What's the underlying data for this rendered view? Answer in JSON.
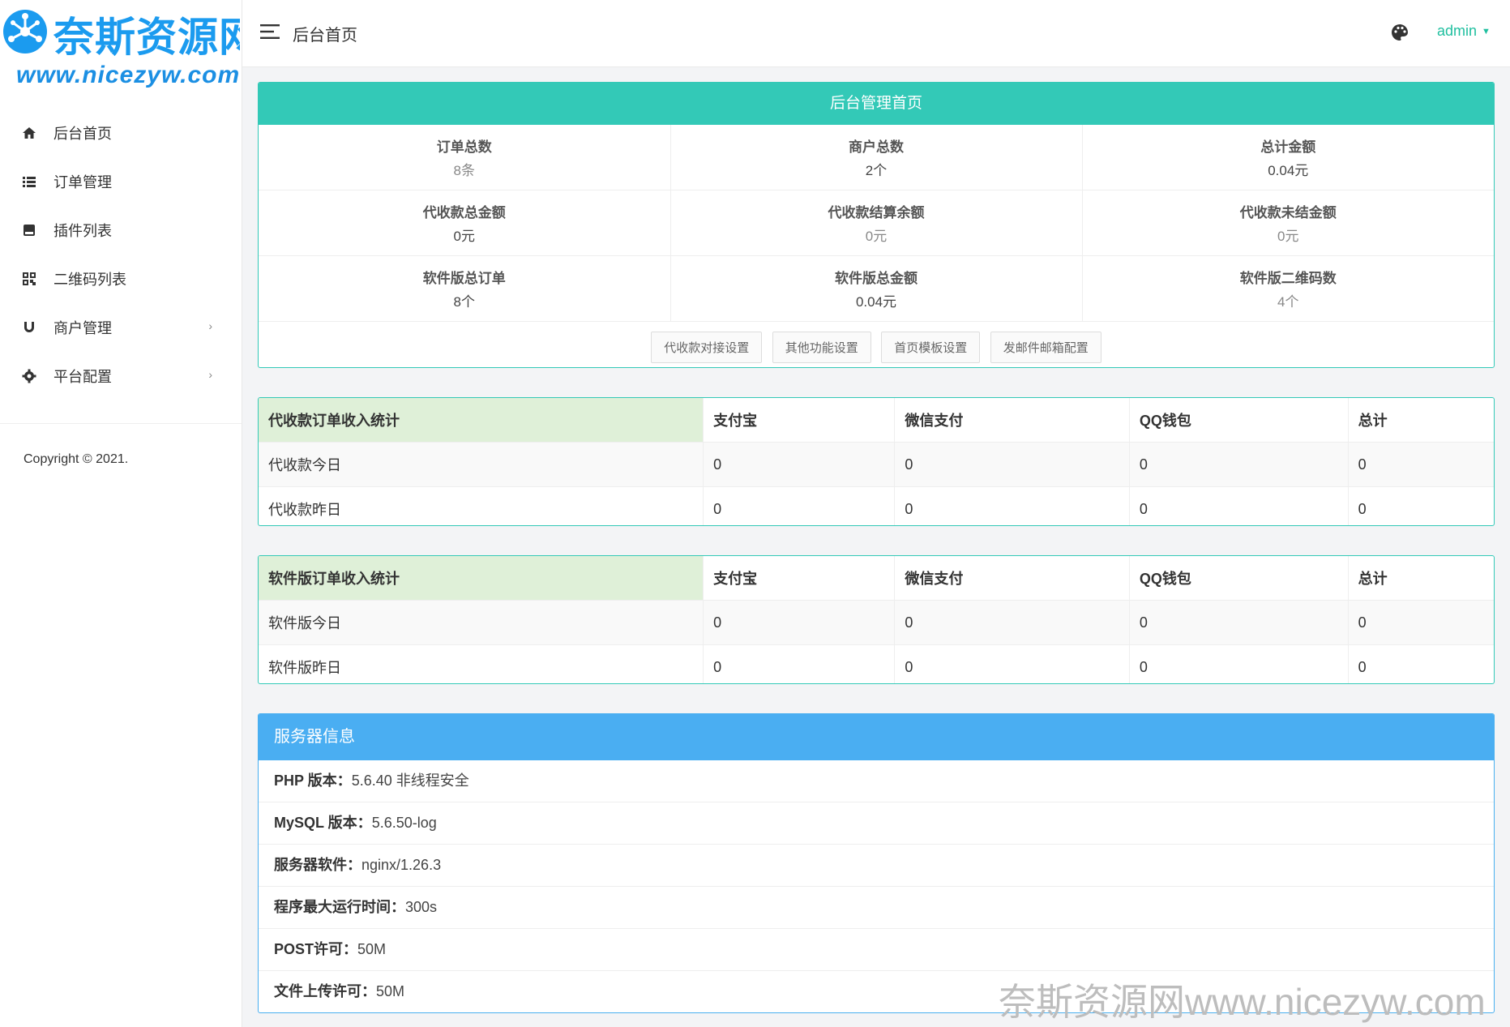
{
  "logo": {
    "title": "奈斯资源网",
    "url": "www.nicezyw.com"
  },
  "sidebar": {
    "items": [
      {
        "label": "后台首页",
        "icon": "home-icon"
      },
      {
        "label": "订单管理",
        "icon": "list-icon"
      },
      {
        "label": "插件列表",
        "icon": "plugin-icon"
      },
      {
        "label": "二维码列表",
        "icon": "qrcode-icon"
      },
      {
        "label": "商户管理",
        "icon": "magnet-icon",
        "arrow": "›"
      },
      {
        "label": "平台配置",
        "icon": "gear-icon",
        "arrow": "›"
      }
    ],
    "copyright": "Copyright © 2021."
  },
  "header": {
    "title": "后台首页",
    "user": "admin"
  },
  "stats": {
    "title": "后台管理首页",
    "cells": [
      {
        "label": "订单总数",
        "value": "8条"
      },
      {
        "label": "商户总数",
        "value": "2个"
      },
      {
        "label": "总计金额",
        "value": "0.04元"
      },
      {
        "label": "代收款总金额",
        "value": "0元"
      },
      {
        "label": "代收款结算余额",
        "value": "0元"
      },
      {
        "label": "代收款未结金额",
        "value": "0元"
      },
      {
        "label": "软件版总订单",
        "value": "8个"
      },
      {
        "label": "软件版总金额",
        "value": "0.04元"
      },
      {
        "label": "软件版二维码数",
        "value": "4个"
      }
    ],
    "buttons": [
      "代收款对接设置",
      "其他功能设置",
      "首页模板设置",
      "发邮件邮箱配置"
    ]
  },
  "income_collect": {
    "headers": [
      "代收款订单收入统计",
      "支付宝",
      "微信支付",
      "QQ钱包",
      "总计"
    ],
    "rows": [
      [
        "代收款今日",
        "0",
        "0",
        "0",
        "0"
      ],
      [
        "代收款昨日",
        "0",
        "0",
        "0",
        "0"
      ]
    ]
  },
  "income_software": {
    "headers": [
      "软件版订单收入统计",
      "支付宝",
      "微信支付",
      "QQ钱包",
      "总计"
    ],
    "rows": [
      [
        "软件版今日",
        "0",
        "0",
        "0",
        "0"
      ],
      [
        "软件版昨日",
        "0",
        "0",
        "0",
        "0"
      ]
    ]
  },
  "server": {
    "title": "服务器信息",
    "rows": [
      {
        "label": "PHP 版本：",
        "value": "5.6.40 非线程安全"
      },
      {
        "label": "MySQL 版本：",
        "value": "5.6.50-log"
      },
      {
        "label": "服务器软件：",
        "value": "nginx/1.26.3"
      },
      {
        "label": "程序最大运行时间：",
        "value": "300s"
      },
      {
        "label": "POST许可：",
        "value": "50M"
      },
      {
        "label": "文件上传许可：",
        "value": "50M"
      }
    ]
  },
  "watermark": "奈斯资源网www.nicezyw.com",
  "colors": {
    "teal": "#33c9b7",
    "blue": "#4aaef2",
    "green_header": "#dff0d8",
    "brand": "#1b9bef"
  }
}
